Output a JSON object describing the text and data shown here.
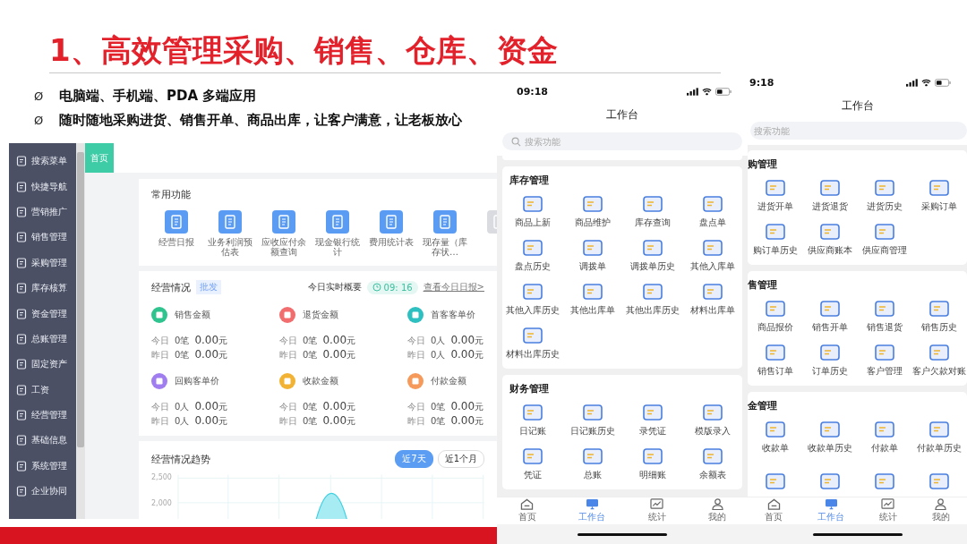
{
  "slide": {
    "title": "1、高效管理采购、销售、仓库、资金",
    "bullets": [
      {
        "marker": "Ø",
        "text": "电脑端、手机端、PDA 多端应用"
      },
      {
        "marker": "Ø",
        "text": "随时随地采购进货、销售开单、商品出库，让客户满意，让老板放心"
      }
    ]
  },
  "desktop": {
    "sidebar": {
      "items": [
        {
          "label": "搜索菜单"
        },
        {
          "label": "快捷导航"
        },
        {
          "label": "营销推广"
        },
        {
          "label": "销售管理"
        },
        {
          "label": "采购管理"
        },
        {
          "label": "库存核算"
        },
        {
          "label": "资金管理"
        },
        {
          "label": "总账管理"
        },
        {
          "label": "固定资产"
        },
        {
          "label": "工资"
        },
        {
          "label": "经营管理"
        },
        {
          "label": "基础信息"
        },
        {
          "label": "系统管理"
        },
        {
          "label": "企业协同"
        }
      ]
    },
    "tabs": [
      {
        "label": "首页",
        "selected": true
      }
    ],
    "common_functions": {
      "title": "常用功能",
      "items": [
        {
          "kind": "full",
          "label": "经营日报"
        },
        {
          "kind": "full",
          "label": "业务利润预估表"
        },
        {
          "kind": "full",
          "label": "应收应付余额查询"
        },
        {
          "kind": "full",
          "label": "现金银行统计"
        },
        {
          "kind": "full",
          "label": "费用统计表"
        },
        {
          "kind": "full",
          "label": "现存量（库存状…"
        },
        {
          "kind": "cut"
        }
      ]
    },
    "overview": {
      "title": "经营情况",
      "tag": "批发",
      "realtime_label": "今日实时概要",
      "time": "09: 16",
      "link": "查看今日日报>",
      "metrics": [
        {
          "name": "销售金额",
          "color": "#2fc38f",
          "rows": [
            {
              "day": "今日",
              "count": "0笔",
              "amount": "0.00",
              "unit": "元"
            },
            {
              "day": "昨日",
              "count": "0笔",
              "amount": "0.00",
              "unit": "元"
            }
          ]
        },
        {
          "name": "退货金额",
          "color": "#f26d6d",
          "rows": [
            {
              "day": "今日",
              "count": "0笔",
              "amount": "0.00",
              "unit": "元"
            },
            {
              "day": "昨日",
              "count": "0笔",
              "amount": "0.00",
              "unit": "元"
            }
          ]
        },
        {
          "name": "首客客单价",
          "color": "#2ebfc0",
          "rows": [
            {
              "day": "今日",
              "count": "0人",
              "amount": "0.00",
              "unit": "元"
            },
            {
              "day": "昨日",
              "count": "0人",
              "amount": "0.00",
              "unit": "元"
            }
          ]
        },
        {
          "name": "回购客单价",
          "color": "#a07ef0",
          "rows": [
            {
              "day": "今日",
              "count": "0人",
              "amount": "0.00",
              "unit": "元"
            },
            {
              "day": "昨日",
              "count": "0人",
              "amount": "0.00",
              "unit": "元"
            }
          ]
        },
        {
          "name": "收款金额",
          "color": "#f2b234",
          "rows": [
            {
              "day": "今日",
              "count": "0笔",
              "amount": "0.00",
              "unit": "元"
            },
            {
              "day": "昨日",
              "count": "0笔",
              "amount": "0.00",
              "unit": "元"
            }
          ]
        },
        {
          "name": "付款金额",
          "color": "#f59a5a",
          "rows": [
            {
              "day": "今日",
              "count": "0笔",
              "amount": "0.00",
              "unit": "元"
            },
            {
              "day": "昨日",
              "count": "0笔",
              "amount": "0.00",
              "unit": "元"
            }
          ]
        }
      ]
    },
    "trend": {
      "title": "经营情况趋势",
      "ranges": [
        {
          "label": "近7天",
          "selected": true
        },
        {
          "label": "近1个月",
          "selected": false
        }
      ],
      "y_tick_labels": [
        "2,500",
        "2,000"
      ]
    }
  },
  "phones": [
    {
      "status_time": "09:18",
      "title": "工作台",
      "search": {
        "placeholder": "搜索功能",
        "icon": true
      },
      "sections": [
        {
          "title": "库存管理",
          "items": [
            {
              "kind": "full",
              "label": "商品上新"
            },
            {
              "kind": "full",
              "label": "商品维护"
            },
            {
              "kind": "full",
              "label": "库存查询"
            },
            {
              "kind": "full",
              "label": "盘点单"
            },
            {
              "kind": "full",
              "label": "盘点历史"
            },
            {
              "kind": "full",
              "label": "调拨单"
            },
            {
              "kind": "full",
              "label": "调拨单历史"
            },
            {
              "kind": "full",
              "label": "其他入库单"
            },
            {
              "kind": "full",
              "label": "其他入库历史"
            },
            {
              "kind": "full",
              "label": "其他出库单"
            },
            {
              "kind": "full",
              "label": "其他出库历史"
            },
            {
              "kind": "full",
              "label": "材料出库单"
            },
            {
              "kind": "full",
              "label": "材料出库历史"
            }
          ]
        },
        {
          "title": "财务管理",
          "items": [
            {
              "kind": "full",
              "label": "日记账"
            },
            {
              "kind": "full",
              "label": "日记账历史"
            },
            {
              "kind": "full",
              "label": "录凭证"
            },
            {
              "kind": "full",
              "label": "模版录入"
            },
            {
              "kind": "full",
              "label": "凭证"
            },
            {
              "kind": "full",
              "label": "总账"
            },
            {
              "kind": "full",
              "label": "明细账"
            },
            {
              "kind": "full",
              "label": "余额表"
            }
          ]
        }
      ],
      "tab_bar": [
        {
          "label": "首页",
          "selected": false
        },
        {
          "label": "工作台",
          "selected": true
        },
        {
          "label": "统计",
          "selected": false
        },
        {
          "label": "我的",
          "selected": false
        }
      ]
    },
    {
      "status_time": "9:18",
      "title": "工作台",
      "search": {
        "placeholder": "搜索功能",
        "icon": false
      },
      "sections": [
        {
          "title": "购管理",
          "items": [
            {
              "kind": "full",
              "label": "进货开单"
            },
            {
              "kind": "full",
              "label": "进货退货"
            },
            {
              "kind": "full",
              "label": "进货历史"
            },
            {
              "kind": "full",
              "label": "采购订单"
            },
            {
              "kind": "full",
              "label": "购订单历史"
            },
            {
              "kind": "full",
              "label": "供应商账本"
            },
            {
              "kind": "full",
              "label": "供应商管理"
            }
          ]
        },
        {
          "title": "售管理",
          "items": [
            {
              "kind": "full",
              "label": "商品报价"
            },
            {
              "kind": "full",
              "label": "销售开单"
            },
            {
              "kind": "full",
              "label": "销售退货"
            },
            {
              "kind": "full",
              "label": "销售历史"
            },
            {
              "kind": "full",
              "label": "销售订单"
            },
            {
              "kind": "full",
              "label": "订单历史"
            },
            {
              "kind": "full",
              "label": "客户管理"
            },
            {
              "kind": "full",
              "label": "客户欠款对账"
            }
          ]
        },
        {
          "title": "金管理",
          "items": [
            {
              "kind": "full",
              "label": "收款单"
            },
            {
              "kind": "full",
              "label": "收款单历史"
            },
            {
              "kind": "full",
              "label": "付款单"
            },
            {
              "kind": "full",
              "label": "付款单历史"
            },
            {
              "kind": "cut"
            },
            {
              "kind": "cut"
            },
            {
              "kind": "cut"
            },
            {
              "kind": "cut"
            }
          ]
        }
      ],
      "tab_bar": [
        {
          "label": "首页",
          "selected": false
        },
        {
          "label": "工作台",
          "selected": true
        },
        {
          "label": "统计",
          "selected": false
        },
        {
          "label": "我的",
          "selected": false
        }
      ]
    }
  ]
}
